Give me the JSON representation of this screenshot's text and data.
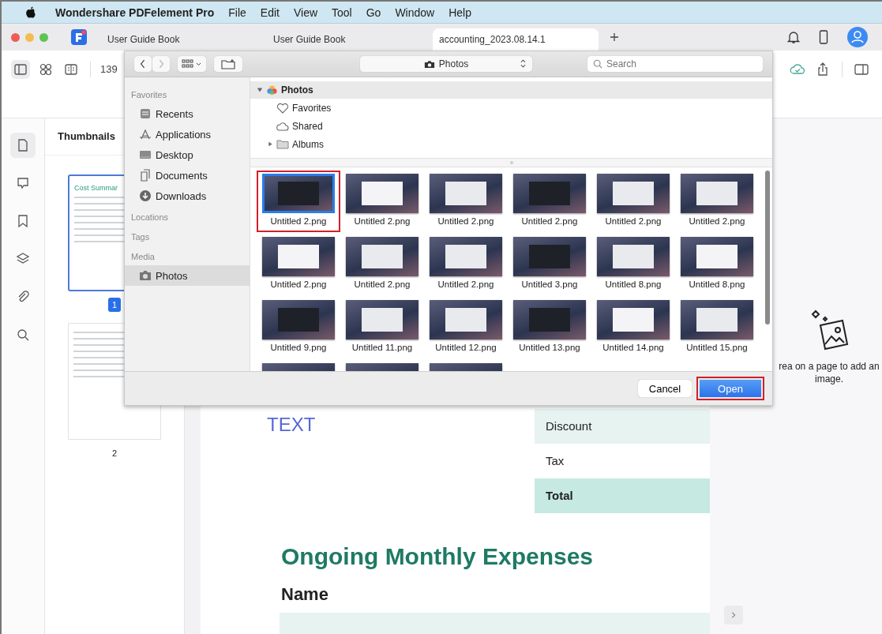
{
  "menu_bar": {
    "app": "Wondershare PDFelement Pro",
    "items": [
      "File",
      "Edit",
      "View",
      "Tool",
      "Go",
      "Window",
      "Help"
    ]
  },
  "tabs": [
    {
      "label": "User Guide Book",
      "selected": false
    },
    {
      "label": "User Guide Book",
      "selected": false
    },
    {
      "label": "accounting_2023.08.14.1",
      "selected": true
    }
  ],
  "toolbar": {
    "zoom": "139"
  },
  "left_rail": [
    {
      "kind": "page",
      "selected": true
    },
    {
      "kind": "comment",
      "selected": false
    },
    {
      "kind": "bookmark",
      "selected": false
    },
    {
      "kind": "layers",
      "selected": false
    },
    {
      "kind": "attachment",
      "selected": false
    },
    {
      "kind": "search",
      "selected": false
    }
  ],
  "thumbnails": {
    "title": "Thumbnails",
    "pages": [
      {
        "label": "1",
        "heading": "Cost Summar",
        "selected": true
      },
      {
        "label": "2",
        "selected": false
      }
    ]
  },
  "document": {
    "text_box": "TEXT",
    "summary_rows": [
      {
        "label": "Discount",
        "kind": "light"
      },
      {
        "label": "Tax",
        "kind": "plain"
      },
      {
        "label": "Total",
        "kind": "total"
      }
    ],
    "heading": "Ongoing Monthly Expenses",
    "subheading": "Name"
  },
  "image_panel": {
    "hint": "rea on a page to add an image."
  },
  "dialog": {
    "location": "Photos",
    "search": {
      "placeholder": "Search"
    },
    "sidebar": [
      {
        "title": "Favorites",
        "items": [
          {
            "label": "Recents",
            "kind": "recents",
            "selected": false
          },
          {
            "label": "Applications",
            "kind": "applications",
            "selected": false
          },
          {
            "label": "Desktop",
            "kind": "desktop",
            "selected": false
          },
          {
            "label": "Documents",
            "kind": "documents",
            "selected": false
          },
          {
            "label": "Downloads",
            "kind": "downloads",
            "selected": false
          }
        ]
      },
      {
        "title": "Locations"
      },
      {
        "title": "Tags"
      },
      {
        "title": "Media",
        "items": [
          {
            "label": "Photos",
            "kind": "photos",
            "selected": true
          }
        ]
      }
    ],
    "tree": {
      "label": "Photos",
      "expanded": true,
      "children": [
        {
          "label": "Favorites",
          "kind": "heart"
        },
        {
          "label": "Shared",
          "kind": "cloud"
        },
        {
          "label": "Albums",
          "kind": "folder",
          "expanded": false
        }
      ]
    },
    "photos": [
      {
        "name": "Untitled 2.png",
        "selected": true,
        "highlighted": true
      },
      {
        "name": "Untitled 2.png",
        "selected": false,
        "highlighted": false
      },
      {
        "name": "Untitled 2.png",
        "selected": false,
        "highlighted": false
      },
      {
        "name": "Untitled 2.png",
        "selected": false,
        "highlighted": false
      },
      {
        "name": "Untitled 2.png",
        "selected": false,
        "highlighted": false
      },
      {
        "name": "Untitled 2.png",
        "selected": false,
        "highlighted": false
      },
      {
        "name": "Untitled 2.png",
        "selected": false,
        "highlighted": false
      },
      {
        "name": "Untitled 2.png",
        "selected": false,
        "highlighted": false
      },
      {
        "name": "Untitled 2.png",
        "selected": false,
        "highlighted": false
      },
      {
        "name": "Untitled 3.png",
        "selected": false,
        "highlighted": false
      },
      {
        "name": "Untitled 8.png",
        "selected": false,
        "highlighted": false
      },
      {
        "name": "Untitled 8.png",
        "selected": false,
        "highlighted": false
      },
      {
        "name": "Untitled 9.png",
        "selected": false,
        "highlighted": false
      },
      {
        "name": "Untitled 11.png",
        "selected": false,
        "highlighted": false
      },
      {
        "name": "Untitled 12.png",
        "selected": false,
        "highlighted": false
      },
      {
        "name": "Untitled 13.png",
        "selected": false,
        "highlighted": false
      },
      {
        "name": "Untitled 14.png",
        "selected": false,
        "highlighted": false
      },
      {
        "name": "Untitled 15.png",
        "selected": false,
        "highlighted": false
      },
      {
        "selected": false,
        "highlighted": false
      },
      {
        "selected": false,
        "highlighted": false
      },
      {
        "selected": false,
        "highlighted": false
      }
    ],
    "buttons": [
      {
        "label": "Cancel",
        "kind": "cancel",
        "highlighted": false
      },
      {
        "label": "Open",
        "kind": "default",
        "highlighted": true
      }
    ]
  }
}
